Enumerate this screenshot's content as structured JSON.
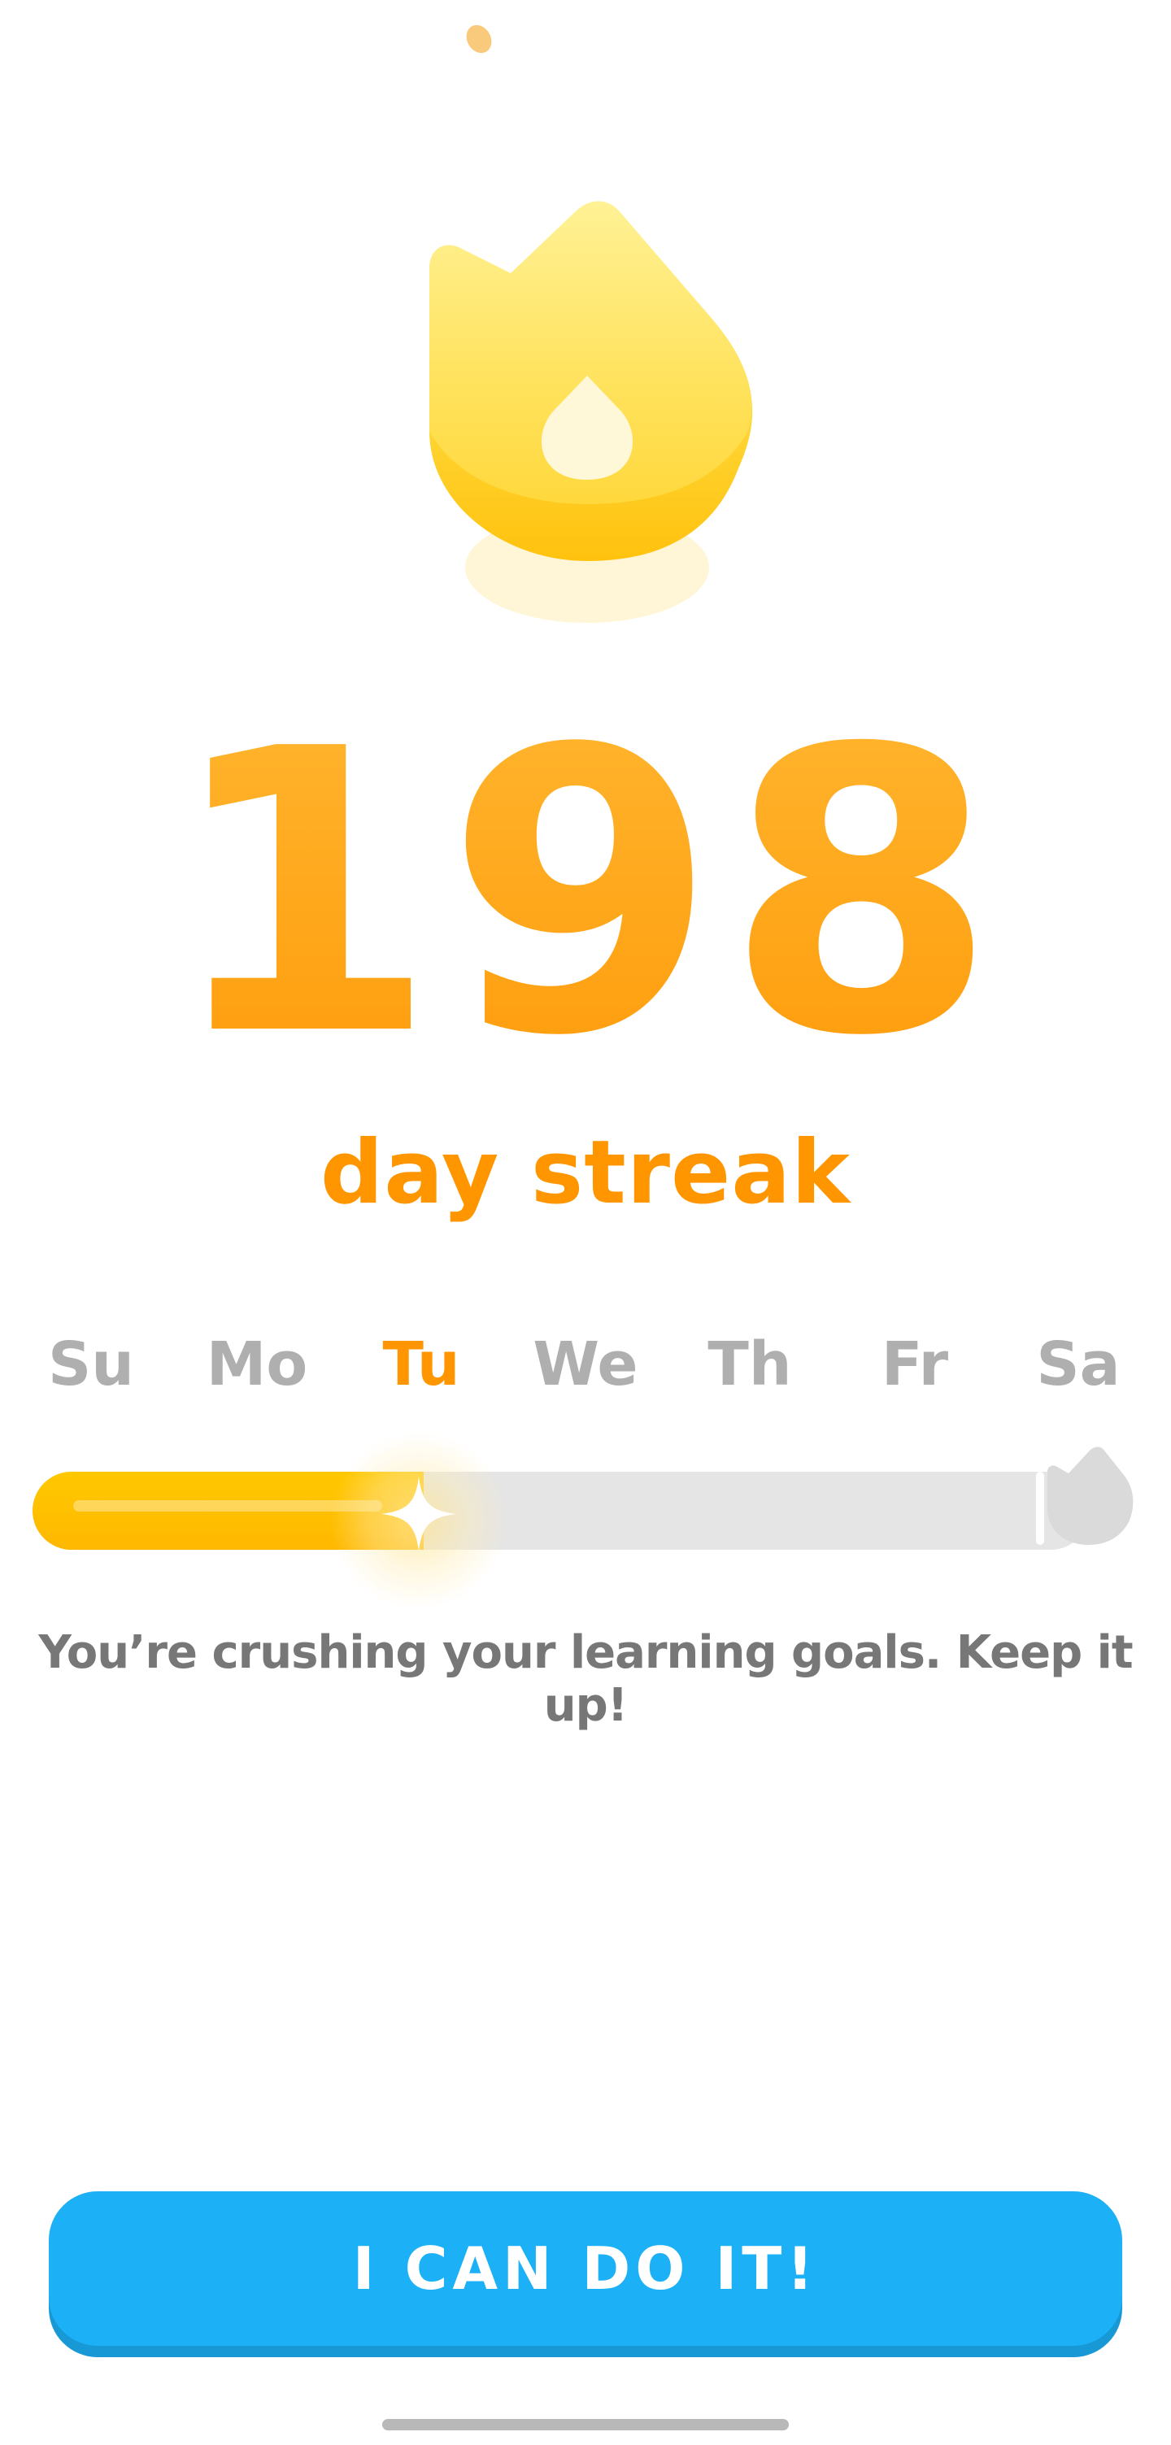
{
  "streak": {
    "count": "198",
    "label": "day streak"
  },
  "week": {
    "days": [
      "Su",
      "Mo",
      "Tu",
      "We",
      "Th",
      "Fr",
      "Sa"
    ],
    "active_day": "Tu",
    "progress_fraction": 0.37
  },
  "message": "You’re crushing your learning goals. Keep it up!",
  "cta": {
    "label": "I CAN DO IT!"
  },
  "icons": {
    "hero": "flame-icon",
    "progress_marker": "sparkle-icon",
    "goal_marker": "flame-icon"
  },
  "colors": {
    "streak_orange": "#ff9600",
    "progress_yellow": "#ffc800",
    "inactive_gray": "#afafaf",
    "button_blue": "#1cb0f6",
    "button_shadow": "#1899d6"
  }
}
